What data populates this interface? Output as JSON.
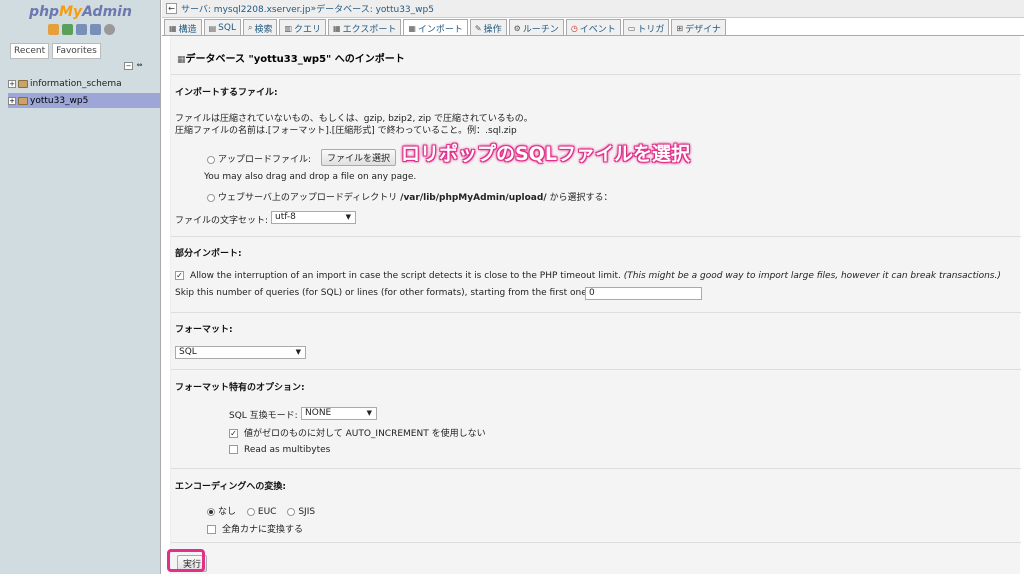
{
  "sidebar": {
    "logo_php": "php",
    "logo_my": "My",
    "logo_admin": "Admin",
    "tabs": [
      "Recent",
      "Favorites"
    ],
    "databases": [
      "information_schema",
      "yottu33_wp5"
    ]
  },
  "topbar": {
    "arrow": "←",
    "server_label": "サーバ: mysql2208.xserver.jp",
    "sep": " » ",
    "db_label": "データベース: yottu33_wp5"
  },
  "tabs": [
    {
      "icon": "structure-icon",
      "label": "構造"
    },
    {
      "icon": "sql-icon",
      "label": "SQL"
    },
    {
      "icon": "search-icon",
      "label": "検索"
    },
    {
      "icon": "query-icon",
      "label": "クエリ"
    },
    {
      "icon": "export-icon",
      "label": "エクスポート"
    },
    {
      "icon": "import-icon",
      "label": "インポート"
    },
    {
      "icon": "operations-icon",
      "label": "操作"
    },
    {
      "icon": "routines-icon",
      "label": "ルーチン"
    },
    {
      "icon": "events-icon",
      "label": "イベント"
    },
    {
      "icon": "triggers-icon",
      "label": "トリガ"
    },
    {
      "icon": "designer-icon",
      "label": "デザイナ"
    }
  ],
  "active_tab": "インポート",
  "main": {
    "title": "データベース \"yottu33_wp5\" へのインポート",
    "file_section": "インポートするファイル:",
    "file_note1": "ファイルは圧縮されていないもの、もしくは、gzip, bzip2, zip で圧縮されているもの。",
    "file_note2": "圧縮ファイルの名前は.[フォーマット].[圧縮形式] で終わっていること。例：.sql.zip",
    "upload_label": "アップロードファイル:",
    "choose_file_button": "ファイルを選択",
    "annotation": "ロリポップのSQLファイルを選択",
    "drag_note": "You may also drag and drop a file on any page.",
    "webserver_label": "ウェブサーバ上のアップロードディレクトリ",
    "webserver_path": "/var/lib/phpMyAdmin/upload/",
    "webserver_suffix": "から選択する：",
    "charset_label": "ファイルの文字セット:",
    "charset_value": "utf-8",
    "partial_section": "部分インポート:",
    "allow_interrupt": "Allow the interruption of an import in case the script detects it is close to the PHP timeout limit.",
    "allow_interrupt_note": "(This might be a good way to import large files, however it can break transactions.)",
    "skip_label": "Skip this number of queries (for SQL) or lines (for other formats), starting from the first one:",
    "skip_value": "0",
    "format_section": "フォーマット:",
    "format_value": "SQL",
    "format_opts_section": "フォーマット特有のオプション:",
    "sql_compat_label": "SQL 互換モード:",
    "sql_compat_value": "NONE",
    "auto_inc_label": "値がゼロのものに対して AUTO_INCREMENT を使用しない",
    "multibytes_label": "Read as multibytes",
    "encoding_section": "エンコーディングへの変換:",
    "enc_none": "なし",
    "enc_euc": "EUC",
    "enc_sjis": "SJIS",
    "zenkaku_label": "全角カナに変換する",
    "go_button": "実行"
  },
  "colors": {
    "accent": "#e0308a",
    "sidebar_bg": "#d0dce0",
    "selected_db": "#9da6d6",
    "link": "#235a81"
  }
}
